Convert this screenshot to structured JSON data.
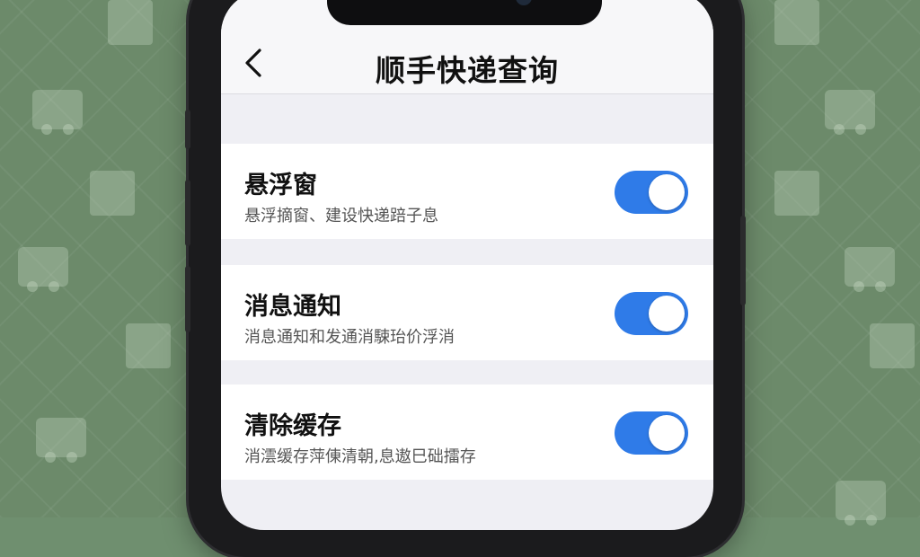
{
  "header": {
    "title": "顺手快递查询",
    "back_icon": "chevron-left-icon"
  },
  "settings": [
    {
      "title": "悬浮窗",
      "subtitle": "悬浮摘窗、建设快递踣子息",
      "enabled": true
    },
    {
      "title": "消息通知",
      "subtitle": "消息通知和发通消駷珆价浮消",
      "enabled": true
    },
    {
      "title": "清除缓存",
      "subtitle": "消澐缓存萍倲清朝,息遨巳础擂存",
      "enabled": true
    }
  ],
  "colors": {
    "toggle_on": "#2f7be8",
    "background": "#6c8a6a",
    "screen_bg": "#efeff4"
  }
}
